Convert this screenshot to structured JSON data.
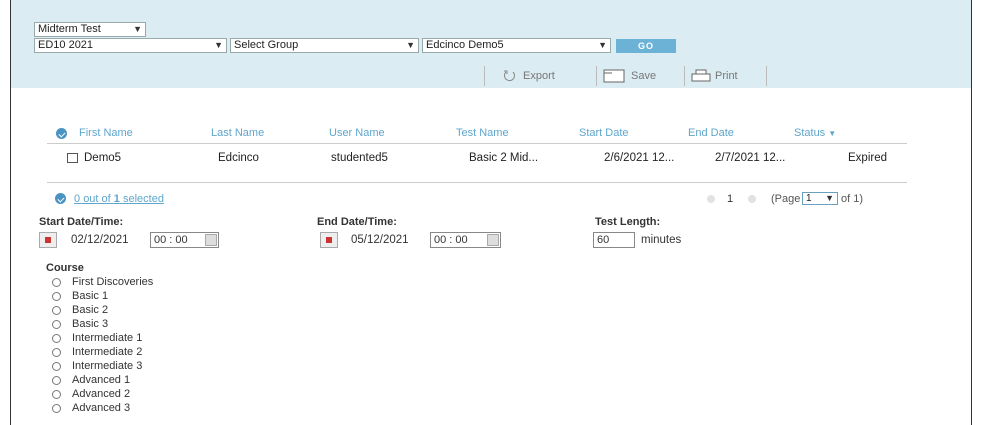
{
  "filters": {
    "test_type": "Midterm Test",
    "class": "ED10 2021",
    "group": "Select Group",
    "school": "Edcinco Demo5",
    "go_label": "GO"
  },
  "toolbar": {
    "export": "Export",
    "save": "Save",
    "print": "Print"
  },
  "table": {
    "headers": [
      "First Name",
      "Last Name",
      "User Name",
      "Test Name",
      "Start Date",
      "End Date",
      "Status"
    ],
    "rows": [
      {
        "first_name": "Demo5",
        "last_name": "Edcinco",
        "user_name": "studented5",
        "test_name": "Basic 2 Mid...",
        "start_date": "2/6/2021 12...",
        "end_date": "2/7/2021 12...",
        "status": "Expired"
      }
    ]
  },
  "selection": {
    "count": "0",
    "middle": "out of",
    "total": "1",
    "suffix": "selected"
  },
  "pager": {
    "current": "1",
    "page_prefix": "(Page",
    "page_select": "1",
    "page_suffix": "of  1)"
  },
  "schedule": {
    "start_label": "Start Date/Time:",
    "start_date": "02/12/2021",
    "start_time": "00 : 00",
    "end_label": "End Date/Time:",
    "end_date": "05/12/2021",
    "end_time": "00 : 00",
    "length_label": "Test Length:",
    "length_value": "60",
    "length_unit": "minutes"
  },
  "course": {
    "label": "Course",
    "options": [
      "First Discoveries",
      "Basic 1",
      "Basic 2",
      "Basic 3",
      "Intermediate 1",
      "Intermediate 2",
      "Intermediate 3",
      "Advanced 1",
      "Advanced 2",
      "Advanced 3"
    ]
  },
  "colors": {
    "header_band": "#dcecf3",
    "accent": "#5ea6cc",
    "go_button": "#6cb2d6"
  },
  "icons": {
    "select_chevron": "chevron-down-icon",
    "export": "export-icon",
    "save": "save-icon",
    "print": "print-icon",
    "calendar": "calendar-icon",
    "select_all": "check-circle-icon",
    "sort": "sort-down-icon"
  }
}
